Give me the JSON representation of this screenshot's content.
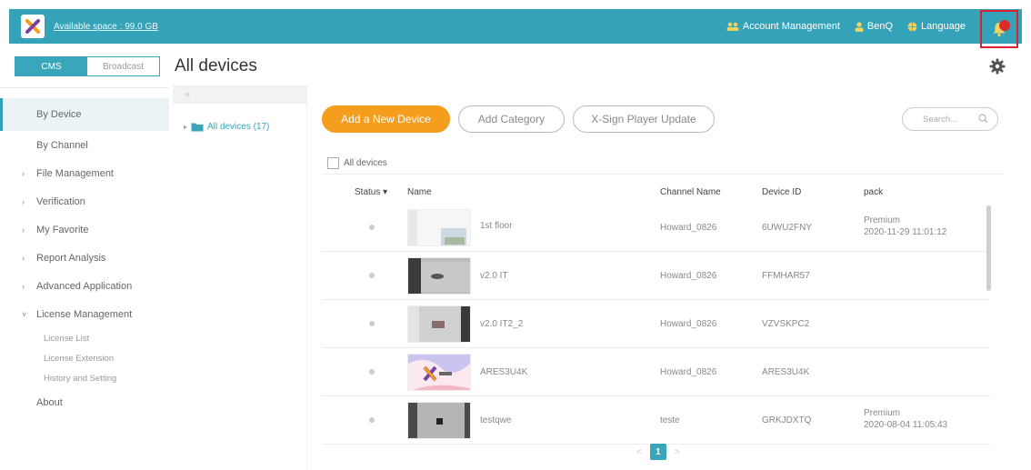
{
  "header": {
    "space_label": "Available space : 99.0 GB",
    "account_management": "Account Management",
    "user": "BenQ",
    "language": "Language",
    "colors": {
      "bar": "#34a3b9",
      "highlight_box": "#d7232f"
    }
  },
  "module_tabs": [
    {
      "label": "CMS",
      "active": true
    },
    {
      "label": "Broadcast",
      "active": false
    }
  ],
  "page_title": "All devices",
  "sidebar": {
    "items": [
      {
        "label": "By Device",
        "active": true
      },
      {
        "label": "By Channel"
      },
      {
        "label": "File Management"
      },
      {
        "label": "Verification"
      },
      {
        "label": "My Favorite"
      },
      {
        "label": "Report Analysis"
      },
      {
        "label": "Advanced Application"
      },
      {
        "label": "License Management",
        "expanded": true
      }
    ],
    "license_sub": [
      "License List",
      "License Extension",
      "History and Setting"
    ],
    "about": "About"
  },
  "tree": {
    "head": "<",
    "node_label": "All devices (17)"
  },
  "actions": {
    "add_device": "Add a New Device",
    "add_category": "Add Category",
    "player_update": "X-Sign Player Update",
    "search_placeholder": "Search..."
  },
  "table": {
    "select_all_label": "All devices",
    "columns": {
      "status": "Status",
      "name": "Name",
      "channel": "Channel Name",
      "device_id": "Device ID",
      "pack": "pack"
    },
    "rows": [
      {
        "name": "1st floor",
        "channel": "Howard_0826",
        "device_id": "6UWU2FNY",
        "pack": "Premium",
        "pack_date": "2020-11-29 11:01:12"
      },
      {
        "name": "v2.0 IT",
        "channel": "Howard_0826",
        "device_id": "FFMHAR57",
        "pack": "",
        "pack_date": ""
      },
      {
        "name": "v2.0 IT2_2",
        "channel": "Howard_0826",
        "device_id": "VZVSKPC2",
        "pack": "",
        "pack_date": ""
      },
      {
        "name": "ARES3U4K",
        "channel": "Howard_0826",
        "device_id": "ARES3U4K",
        "pack": "",
        "pack_date": ""
      },
      {
        "name": "testqwe",
        "channel": "teste",
        "device_id": "GRKJDXTQ",
        "pack": "Premium",
        "pack_date": "2020-08-04 11:05:43"
      }
    ]
  },
  "pagination": {
    "prev": "<",
    "current": "1",
    "next": ">"
  }
}
